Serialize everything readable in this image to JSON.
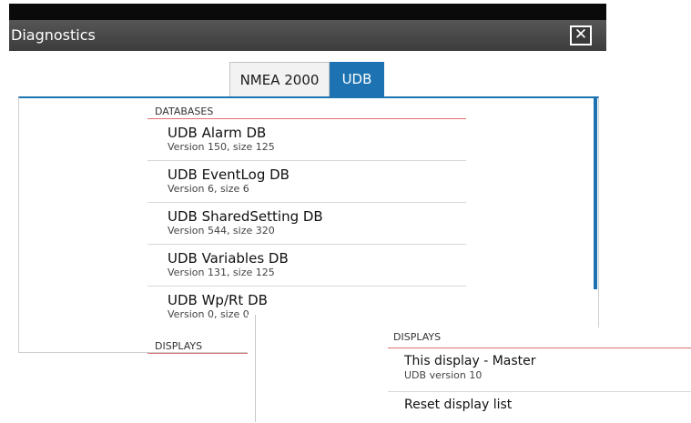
{
  "window": {
    "title": "Diagnostics",
    "close_icon": "close-icon"
  },
  "tabs": [
    {
      "label": "NMEA 2000",
      "active": false
    },
    {
      "label": "UDB",
      "active": true
    }
  ],
  "databases": {
    "header": "DATABASES",
    "items": [
      {
        "title": "UDB Alarm DB",
        "subtitle": "Version 150, size 125"
      },
      {
        "title": "UDB EventLog DB",
        "subtitle": "Version 6, size 6"
      },
      {
        "title": "UDB SharedSetting DB",
        "subtitle": "Version 544, size 320"
      },
      {
        "title": "UDB Variables DB",
        "subtitle": "Version 131, size 125"
      },
      {
        "title": "UDB Wp/Rt DB",
        "subtitle": "Version 0, size 0"
      }
    ]
  },
  "displays_underlay": {
    "header": "DISPLAYS"
  },
  "displays": {
    "header": "DISPLAYS",
    "items": [
      {
        "title": "This display  -  Master",
        "subtitle": "UDB version 10"
      },
      {
        "title": "Reset display list"
      }
    ]
  },
  "colors": {
    "accent": "#1d73b2",
    "divider_accent": "#e07070",
    "titlebar": "#474747"
  }
}
